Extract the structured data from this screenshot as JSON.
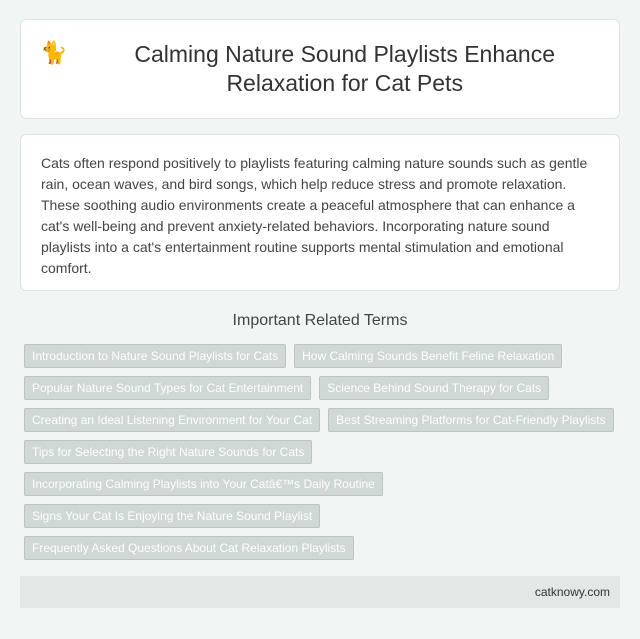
{
  "header": {
    "icon": "cat-icon",
    "title": "Calming Nature Sound Playlists Enhance Relaxation for Cat Pets"
  },
  "description": "Cats often respond positively to playlists featuring calming nature sounds such as gentle rain, ocean waves, and bird songs, which help reduce stress and promote relaxation. These soothing audio environments create a peaceful atmosphere that can enhance a cat's well-being and prevent anxiety-related behaviors. Incorporating nature sound playlists into a cat's entertainment routine supports mental stimulation and emotional comfort.",
  "related": {
    "heading": "Important Related Terms",
    "tags": [
      "Introduction to Nature Sound Playlists for Cats",
      "How Calming Sounds Benefit Feline Relaxation",
      "Popular Nature Sound Types for Cat Entertainment",
      "Science Behind Sound Therapy for Cats",
      "Creating an Ideal Listening Environment for Your Cat",
      "Best Streaming Platforms for Cat-Friendly Playlists",
      "Tips for Selecting the Right Nature Sounds for Cats",
      "Incorporating Calming Playlists into Your Catâ€™s Daily Routine",
      "Signs Your Cat Is Enjoying the Nature Sound Playlist",
      "Frequently Asked Questions About Cat Relaxation Playlists"
    ]
  },
  "footer": {
    "site": "catknowy.com"
  },
  "colors": {
    "background": "#f1f6f4",
    "tag_bg": "#cfd8d4",
    "footer_bg": "#e3e8e6"
  }
}
